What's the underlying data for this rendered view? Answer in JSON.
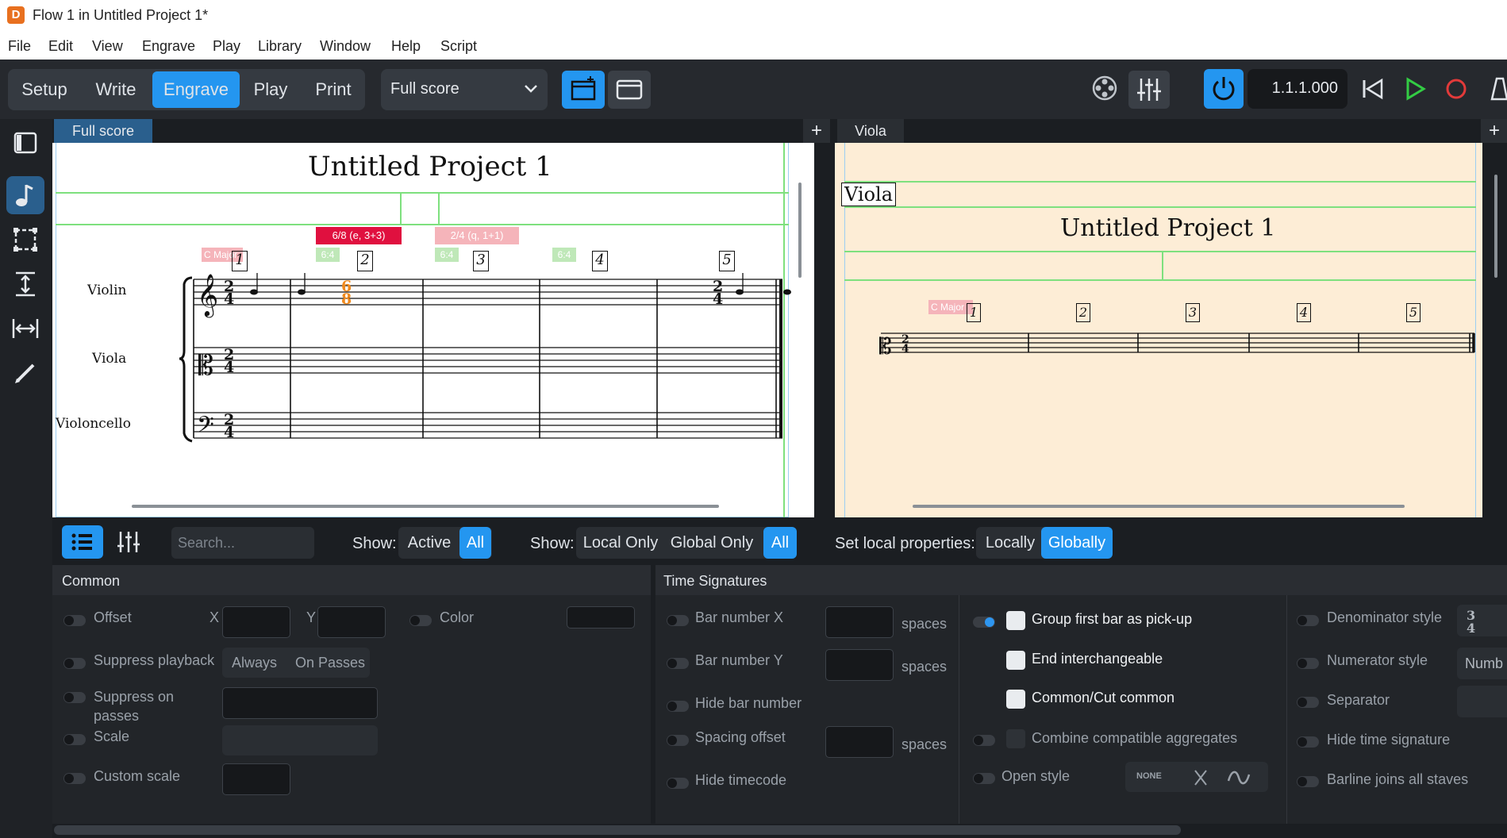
{
  "window": {
    "title": "Flow 1 in Untitled Project 1*"
  },
  "menu": [
    "File",
    "Edit",
    "View",
    "Engrave",
    "Play",
    "Library",
    "Window",
    "Help",
    "Script"
  ],
  "modes": [
    "Setup",
    "Write",
    "Engrave",
    "Play",
    "Print"
  ],
  "layout_select": {
    "value": "Full score"
  },
  "transport": {
    "position": "1.1.1.000"
  },
  "tabs": {
    "left": "Full score",
    "right": "Viola"
  },
  "score_left": {
    "title": "Untitled Project 1",
    "instruments": [
      "Violin",
      "Viola",
      "Violoncello"
    ],
    "time_sig_top": "2",
    "time_sig_bottom": "4",
    "signposts": {
      "key": "C Major",
      "ts1": "6/8 (e, 3+3)",
      "ts2": "2/4 (q, 1+1)",
      "frac1": "6:4",
      "frac2": "6:4",
      "frac3": "6:4"
    },
    "bar_numbers": [
      "1",
      "2",
      "3",
      "4",
      "5"
    ]
  },
  "score_right": {
    "instrument": "Viola",
    "title": "Untitled Project 1",
    "key": "C Major",
    "bar_numbers": [
      "1",
      "2",
      "3",
      "4",
      "5"
    ]
  },
  "props_bar": {
    "search_placeholder": "Search...",
    "show1_label": "Show:",
    "show1": [
      "Active",
      "All"
    ],
    "show2_label": "Show:",
    "show2": [
      "Local Only",
      "Global Only",
      "All"
    ],
    "set_label": "Set local properties:",
    "set": [
      "Locally",
      "Globally"
    ]
  },
  "common": {
    "heading": "Common",
    "offset": "Offset",
    "x": "X",
    "y": "Y",
    "color": "Color",
    "suppress_playback": "Suppress playback",
    "always": "Always",
    "on_passes": "On Passes",
    "suppress_on_passes": "Suppress on passes",
    "scale": "Scale",
    "custom_scale": "Custom scale"
  },
  "time_sigs": {
    "heading": "Time Signatures",
    "bar_number_x": "Bar number X",
    "bar_number_y": "Bar number Y",
    "hide_bar_number": "Hide bar number",
    "spacing_offset": "Spacing offset",
    "hide_timecode": "Hide timecode",
    "spaces": "spaces",
    "group_first_bar": "Group first bar as pick-up",
    "end_interchangeable": "End interchangeable",
    "common_cut": "Common/Cut common",
    "combine": "Combine compatible aggregates",
    "open_style": "Open style",
    "none": "NONE",
    "denominator_style": "Denominator style",
    "numerator_style": "Numerator style",
    "numerator_value": "Numb",
    "separator": "Separator",
    "hide_time_signature": "Hide time signature",
    "barline_joins": "Barline joins all staves"
  }
}
